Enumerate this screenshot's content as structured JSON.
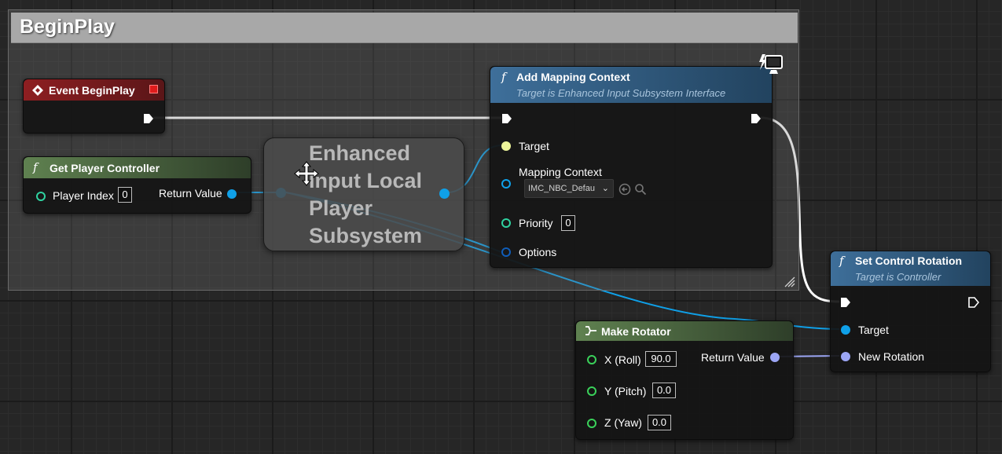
{
  "comment": {
    "title": "BeginPlay"
  },
  "event_begin_play": {
    "title": "Event BeginPlay"
  },
  "get_player_controller": {
    "title": "Get Player Controller",
    "player_index_label": "Player Index",
    "player_index_value": "0",
    "return_label": "Return Value"
  },
  "enhanced_subsystem": {
    "title": "Enhanced Input Local Player Subsystem"
  },
  "add_mapping_context": {
    "title": "Add Mapping Context",
    "subtitle": "Target is Enhanced Input Subsystem Interface",
    "target_label": "Target",
    "mapping_context_label": "Mapping Context",
    "mapping_context_value": "IMC_NBC_Defau",
    "priority_label": "Priority",
    "priority_value": "0",
    "options_label": "Options"
  },
  "make_rotator": {
    "title": "Make Rotator",
    "x_label": "X (Roll)",
    "x_value": "90.0",
    "y_label": "Y (Pitch)",
    "y_value": "0.0",
    "z_label": "Z (Yaw)",
    "z_value": "0.0",
    "return_label": "Return Value"
  },
  "set_control_rotation": {
    "title": "Set Control Rotation",
    "subtitle": "Target is Controller",
    "target_label": "Target",
    "new_rotation_label": "New Rotation"
  },
  "icons": [
    "event-icon",
    "function-icon",
    "make-struct-icon",
    "server-only-icon",
    "use-asset-icon",
    "browse-icon",
    "move-cursor-icon",
    "resize-grip-icon"
  ],
  "colors": {
    "exec_wire": "#ffffff",
    "object_wire": "#0fa0e8",
    "struct_wire": "#9ca6f5",
    "float_pin": "#3ad15a",
    "int_pin": "#2fd2a0",
    "event_header": "#8e1e21",
    "pure_header": "#5f8150",
    "function_header": "#3e6f9a"
  }
}
